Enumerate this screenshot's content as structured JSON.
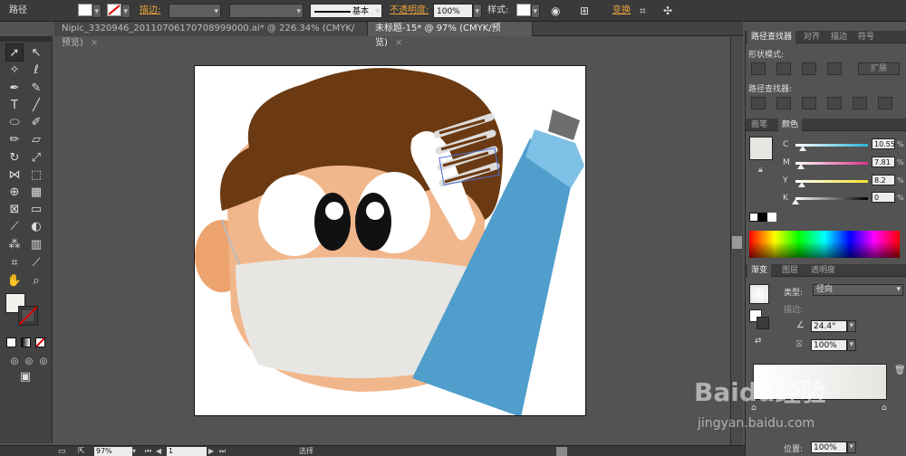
{
  "control_bar": {
    "object_type": "路径",
    "stroke_label": "描边:",
    "stroke_style": "基本",
    "opacity_label": "不透明度:",
    "opacity_value": "100%",
    "style_label": "样式:",
    "transform_label": "变换"
  },
  "tabs": [
    {
      "label": "Nipic_3320946_20110706170708999000.ai* @ 226.34% (CMYK/预览)",
      "close": "×"
    },
    {
      "label": "未标题-15* @ 97% (CMYK/预览)",
      "close": "×"
    }
  ],
  "pathfinder": {
    "tabs": [
      "路径查找器",
      "对齐",
      "描边",
      "符号"
    ],
    "shape_modes_label": "形状模式:",
    "expand_label": "扩展",
    "pathfinders_label": "路径查找器:"
  },
  "color_panel": {
    "tabs": [
      "画笔",
      "颜色"
    ],
    "channels": [
      {
        "name": "C",
        "value": "10.55",
        "fraction": 0.1055,
        "unit": "%"
      },
      {
        "name": "M",
        "value": "7.81",
        "fraction": 0.0781,
        "unit": "%"
      },
      {
        "name": "Y",
        "value": "8.2",
        "fraction": 0.082,
        "unit": "%"
      },
      {
        "name": "K",
        "value": "0",
        "fraction": 0.0,
        "unit": "%"
      }
    ]
  },
  "gradient_panel": {
    "tabs": [
      "渐变",
      "图层",
      "透明度"
    ],
    "type_label": "类型:",
    "type_value": "径向",
    "stroke_label": "描边:",
    "angle_value": "24.4°",
    "ratio_value": "100%",
    "location_label": "位置:",
    "location_value": "100%"
  },
  "status_bar": {
    "zoom": "97%",
    "page": "1",
    "selection": "选择"
  },
  "watermark": {
    "brand": "Baidu经验",
    "url": "jingyan.baidu.com"
  },
  "colors": {
    "hair": "#6b3a12",
    "skin": "#f1b78c",
    "mask": "#e8e6e2",
    "tube": "#4f9ecb",
    "cap": "#6e6e6e",
    "brush_bristle": "#6b3a12"
  }
}
